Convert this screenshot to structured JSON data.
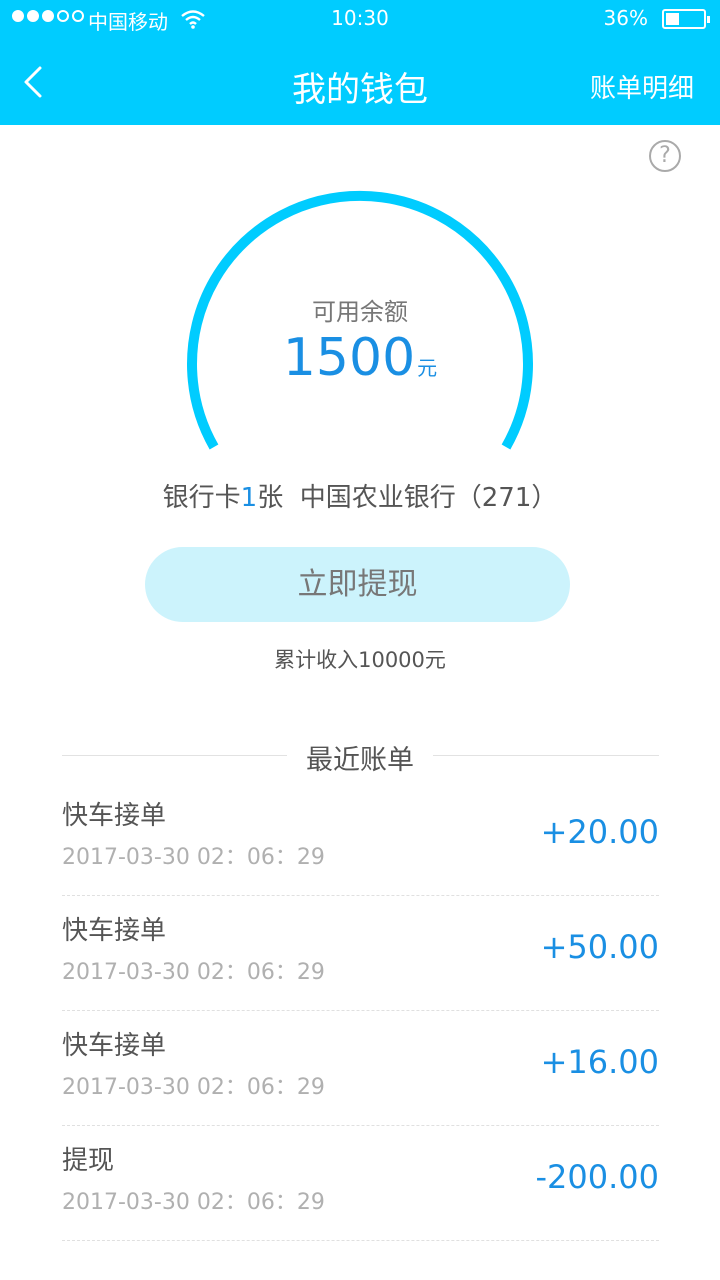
{
  "status_bar": {
    "carrier": "中国移动",
    "time": "10:30",
    "battery": "36%",
    "battery_level": 0.36
  },
  "header": {
    "title": "我的钱包",
    "right_action": "账单明细"
  },
  "balance": {
    "label": "可用余额",
    "amount": "1500",
    "unit": "元"
  },
  "bank": {
    "prefix": "银行卡",
    "count": "1",
    "suffix": "张  中国农业银行（271）"
  },
  "withdraw_button": "立即提现",
  "total_income": "累计收入10000元",
  "recent": {
    "title": "最近账单",
    "items": [
      {
        "name": "快车接单",
        "date": "2017-03-30 02：06：29",
        "amount": "+20.00"
      },
      {
        "name": "快车接单",
        "date": "2017-03-30 02：06：29",
        "amount": "+50.00"
      },
      {
        "name": "快车接单",
        "date": "2017-03-30 02：06：29",
        "amount": "+16.00"
      },
      {
        "name": "提现",
        "date": "2017-03-30 02：06：29",
        "amount": "-200.00"
      }
    ]
  },
  "colors": {
    "header": "#00ccff",
    "accent": "#1a8fe3",
    "button_bg": "#ccf3fc"
  },
  "icons": {
    "back": "chevron-left-icon",
    "help": "question-circle-icon",
    "wifi": "wifi-icon",
    "battery": "battery-icon"
  }
}
